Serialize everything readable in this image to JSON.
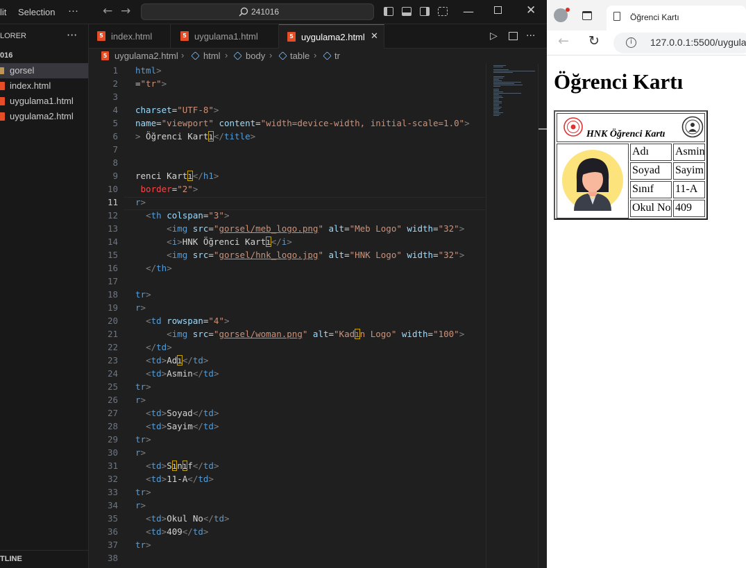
{
  "vscode": {
    "menu": {
      "edit": "lit",
      "selection": "Selection",
      "more": "···"
    },
    "command_center": "241016",
    "explorer": {
      "header": "LORER",
      "folder": "016",
      "items": [
        {
          "label": "gorsel",
          "type": "folder"
        },
        {
          "label": "index.html",
          "type": "html"
        },
        {
          "label": "uygulama1.html",
          "type": "html"
        },
        {
          "label": "uygulama2.html",
          "type": "html"
        }
      ],
      "outline": "TLINE"
    },
    "tabs": [
      {
        "label": "index.html"
      },
      {
        "label": "uygulama1.html"
      },
      {
        "label": "uygulama2.html",
        "active": true
      }
    ],
    "breadcrumb": [
      "uygulama2.html",
      "html",
      "body",
      "table",
      "tr"
    ],
    "current_line": 11,
    "line_count": 38
  },
  "browser": {
    "tab_title": "Öğrenci Kartı",
    "url": "127.0.0.1:5500/uygulam",
    "page": {
      "heading": "Öğrenci Kartı",
      "card_caption": "HNK Öğrenci Kartı",
      "rows": [
        {
          "label": "Adı",
          "value": "Asmin"
        },
        {
          "label": "Soyad",
          "value": "Sayim"
        },
        {
          "label": "Sınıf",
          "value": "11-A"
        },
        {
          "label": "Okul No",
          "value": "409"
        }
      ]
    }
  }
}
